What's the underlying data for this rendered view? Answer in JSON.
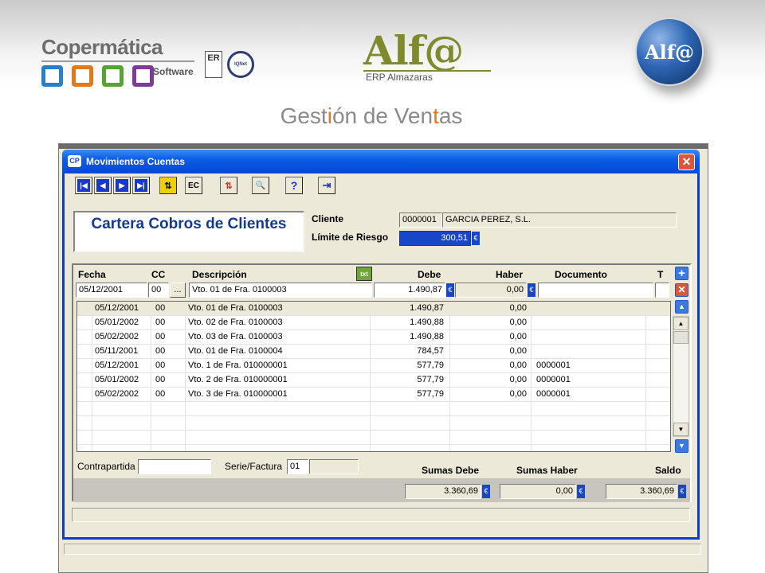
{
  "slide": {
    "brand": "Copermática",
    "brand_sub": "Software",
    "brand_colors": [
      "#2a7fc9",
      "#e07a1c",
      "#58a335",
      "#7d3c98"
    ],
    "cert_er": "ER",
    "cert_iqnet": "IQNet",
    "product": "Alf@",
    "product_tagline": "ERP Almazaras",
    "orb_label": "Alf@",
    "title_parts": [
      "Gest",
      "i",
      "ón de Ven",
      "t",
      "as"
    ]
  },
  "window": {
    "title": "Movimientos Cuentas",
    "app_icon": "CP",
    "close_label": "✕"
  },
  "toolbar": [
    {
      "name": "first-record-button",
      "glyph": "|◀"
    },
    {
      "name": "previous-record-button",
      "glyph": "◀"
    },
    {
      "name": "next-record-button",
      "glyph": "▶"
    },
    {
      "name": "last-record-button",
      "glyph": "▶|"
    },
    {
      "name": "swap-button",
      "glyph": "⇅"
    },
    {
      "name": "ec-button",
      "glyph": "EC"
    },
    {
      "name": "sort-button",
      "glyph": "⇅"
    },
    {
      "name": "search-button",
      "glyph": "🔍"
    },
    {
      "name": "help-button",
      "glyph": "?"
    },
    {
      "name": "exit-button",
      "glyph": "⇥"
    }
  ],
  "header": {
    "module_title": "Cartera Cobros de Clientes",
    "cliente_label": "Cliente",
    "cliente_code": "0000001",
    "cliente_name": "GARCIA PEREZ, S.L.",
    "riesgo_label": "Límite de Riesgo",
    "riesgo_value": "300,51",
    "currency": "€"
  },
  "grid": {
    "columns": {
      "fecha": "Fecha",
      "cc": "CC",
      "descripcion": "Descripción",
      "txt": "txt",
      "debe": "Debe",
      "haber": "Haber",
      "documento": "Documento",
      "t": "T"
    },
    "edit": {
      "fecha": "05/12/2001",
      "cc": "00",
      "lookup": "...",
      "descripcion": "Vto. 01 de Fra. 0100003",
      "debe": "1.490,87",
      "haber": "0,00",
      "documento": "",
      "t": ""
    },
    "rows": [
      {
        "fecha": "05/12/2001",
        "cc": "00",
        "descripcion": "Vto. 01 de Fra. 0100003",
        "debe": "1.490,87",
        "haber": "0,00",
        "documento": ""
      },
      {
        "fecha": "05/01/2002",
        "cc": "00",
        "descripcion": "Vto. 02 de Fra. 0100003",
        "debe": "1.490,88",
        "haber": "0,00",
        "documento": ""
      },
      {
        "fecha": "05/02/2002",
        "cc": "00",
        "descripcion": "Vto. 03 de Fra. 0100003",
        "debe": "1.490,88",
        "haber": "0,00",
        "documento": ""
      },
      {
        "fecha": "05/11/2001",
        "cc": "00",
        "descripcion": "Vto. 01 de Fra. 0100004",
        "debe": "784,57",
        "haber": "0,00",
        "documento": ""
      },
      {
        "fecha": "05/12/2001",
        "cc": "00",
        "descripcion": "Vto. 1 de Fra. 010000001",
        "debe": "577,79",
        "haber": "0,00",
        "documento": "0000001"
      },
      {
        "fecha": "05/01/2002",
        "cc": "00",
        "descripcion": "Vto. 2 de Fra. 010000001",
        "debe": "577,79",
        "haber": "0,00",
        "documento": "0000001"
      },
      {
        "fecha": "05/02/2002",
        "cc": "00",
        "descripcion": "Vto. 3 de Fra. 010000001",
        "debe": "577,79",
        "haber": "0,00",
        "documento": "0000001"
      }
    ],
    "add_label": "+",
    "delete_label": "✕"
  },
  "footer": {
    "contrapartida_label": "Contrapartida",
    "contrapartida_value": "",
    "serie_label": "Serie/Factura",
    "serie_value": "01",
    "factura_value": "",
    "sumas_debe_label": "Sumas Debe",
    "sumas_haber_label": "Sumas Haber",
    "saldo_label": "Saldo",
    "sumas_debe": "3.360,69",
    "sumas_haber": "0,00",
    "saldo": "3.360,69"
  }
}
